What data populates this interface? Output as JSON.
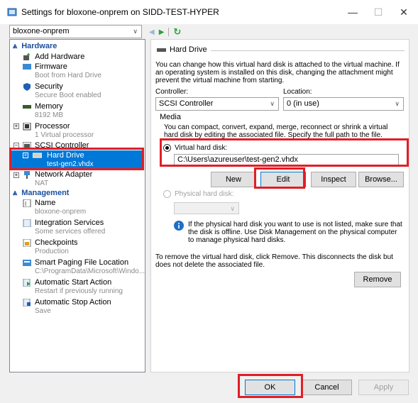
{
  "window": {
    "title": "Settings for bloxone-onprem on SIDD-TEST-HYPER",
    "minimize": "—",
    "maximize": "☐",
    "close": "✕"
  },
  "vm_selector": {
    "value": "bloxone-onprem",
    "chevron": "∨"
  },
  "nav": {
    "back": "◀",
    "forward": "▶",
    "refresh": "↻"
  },
  "tree": {
    "hardware_header": "Hardware",
    "management_header": "Management",
    "items": {
      "add_hardware": {
        "label": "Add Hardware"
      },
      "firmware": {
        "label": "Firmware",
        "sub": "Boot from Hard Drive"
      },
      "security": {
        "label": "Security",
        "sub": "Secure Boot enabled"
      },
      "memory": {
        "label": "Memory",
        "sub": "8192 MB"
      },
      "processor": {
        "label": "Processor",
        "sub": "1 Virtual processor"
      },
      "scsi": {
        "label": "SCSI Controller"
      },
      "hard_drive": {
        "label": "Hard Drive",
        "sub": "test-gen2.vhdx"
      },
      "network": {
        "label": "Network Adapter",
        "sub": "NAT"
      },
      "name": {
        "label": "Name",
        "sub": "bloxone-onprem"
      },
      "integration": {
        "label": "Integration Services",
        "sub": "Some services offered"
      },
      "checkpoints": {
        "label": "Checkpoints",
        "sub": "Production"
      },
      "paging": {
        "label": "Smart Paging File Location",
        "sub": "C:\\ProgramData\\Microsoft\\Windo..."
      },
      "auto_start": {
        "label": "Automatic Start Action",
        "sub": "Restart if previously running"
      },
      "auto_stop": {
        "label": "Automatic Stop Action",
        "sub": "Save"
      }
    }
  },
  "panel": {
    "header": "Hard Drive",
    "intro": "You can change how this virtual hard disk is attached to the virtual machine. If an operating system is installed on this disk, changing the attachment might prevent the virtual machine from starting.",
    "controller_label": "Controller:",
    "controller_value": "SCSI Controller",
    "location_label": "Location:",
    "location_value": "0 (in use)",
    "media_label": "Media",
    "media_text": "You can compact, convert, expand, merge, reconnect or shrink a virtual hard disk by editing the associated file. Specify the full path to the file.",
    "vhd_radio_label": "Virtual hard disk:",
    "vhd_path": "C:\\Users\\azureuser\\test-gen2.vhdx",
    "new_button": "New",
    "edit_button": "Edit",
    "inspect_button": "Inspect",
    "browse_button": "Browse...",
    "physical_radio_label": "Physical hard disk:",
    "physical_info": "If the physical hard disk you want to use is not listed, make sure that the disk is offline. Use Disk Management on the physical computer to manage physical hard disks.",
    "remove_text": "To remove the virtual hard disk, click Remove. This disconnects the disk but does not delete the associated file.",
    "remove_button": "Remove"
  },
  "footer": {
    "ok": "OK",
    "cancel": "Cancel",
    "apply": "Apply"
  },
  "colors": {
    "accent": "#0078d7",
    "highlight_box": "#e01e26",
    "section_header": "#1c4f9e"
  }
}
